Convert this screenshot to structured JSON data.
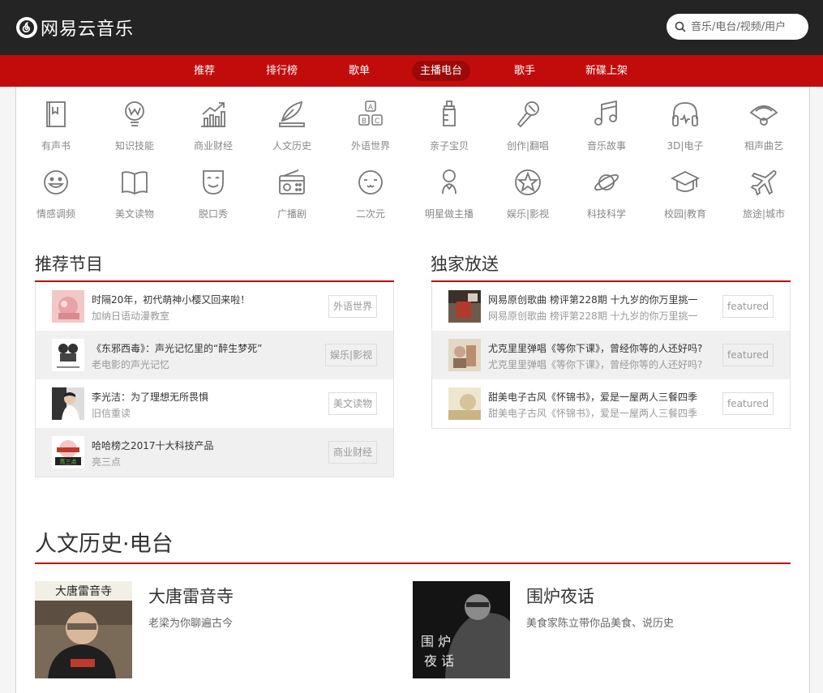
{
  "header": {
    "logo_text": "网易云音乐",
    "search_placeholder": "音乐/电台/视频/用户"
  },
  "nav": {
    "tabs": [
      "推荐",
      "排行榜",
      "歌单",
      "主播电台",
      "歌手",
      "新碟上架"
    ],
    "active": "主播电台"
  },
  "categories": [
    {
      "label": "有声书",
      "icon": "book-icon"
    },
    {
      "label": "知识技能",
      "icon": "lightbulb-icon"
    },
    {
      "label": "商业财经",
      "icon": "chart-icon"
    },
    {
      "label": "人文历史",
      "icon": "feather-icon"
    },
    {
      "label": "外语世界",
      "icon": "abc-blocks-icon"
    },
    {
      "label": "亲子宝贝",
      "icon": "baby-bottle-icon"
    },
    {
      "label": "创作|翻唱",
      "icon": "microphone-icon"
    },
    {
      "label": "音乐故事",
      "icon": "music-note-icon"
    },
    {
      "label": "3D|电子",
      "icon": "headphones-icon"
    },
    {
      "label": "相声曲艺",
      "icon": "fan-icon"
    },
    {
      "label": "情感调频",
      "icon": "smile-icon"
    },
    {
      "label": "美文读物",
      "icon": "open-book-icon"
    },
    {
      "label": "脱口秀",
      "icon": "mask-icon"
    },
    {
      "label": "广播剧",
      "icon": "radio-icon"
    },
    {
      "label": "二次元",
      "icon": "anime-face-icon"
    },
    {
      "label": "明星做主播",
      "icon": "person-icon"
    },
    {
      "label": "娱乐|影视",
      "icon": "star-icon"
    },
    {
      "label": "科技科学",
      "icon": "planet-icon"
    },
    {
      "label": "校园|教育",
      "icon": "graduation-cap-icon"
    },
    {
      "label": "旅途|城市",
      "icon": "airplane-icon"
    }
  ],
  "recommended": {
    "title": "推荐节目",
    "items": [
      {
        "title": "时隔20年，初代萌神小樱又回来啦！",
        "sub": "加纳日语动漫教室",
        "tag": "外语世界"
      },
      {
        "title": "《东邪西毒》：声光记忆里的“醉生梦死”",
        "sub": "老电影的声光记忆",
        "tag": "娱乐|影视"
      },
      {
        "title": "李光洁：为了理想无所畏惧",
        "sub": "旧信重读",
        "tag": "美文读物"
      },
      {
        "title": "哈哈榜之2017十大科技产品",
        "sub": "亮三点",
        "tag": "商业财经"
      }
    ]
  },
  "exclusive": {
    "title": "独家放送",
    "items": [
      {
        "title": "网易原创歌曲 榜评第228期 十九岁的你万里挑一",
        "sub": "网易原创歌曲 榜评第228期 十九岁的你万里挑一",
        "tag": "featured"
      },
      {
        "title": "尤克里里弹唱《等你下课》，曾经你等的人还好吗?",
        "sub": "尤克里里弹唱《等你下课》，曾经你等的人还好吗?",
        "tag": "featured"
      },
      {
        "title": "甜美电子古风《怀锦书》，爱是一屋两人三餐四季",
        "sub": "甜美电子古风《怀锦书》，爱是一屋两人三餐四季",
        "tag": "featured"
      }
    ]
  },
  "history_section": {
    "title": "人文历史·电台",
    "radios": [
      {
        "name": "大唐雷音寺",
        "desc": "老梁为你聊遍古今",
        "cover_text": "大唐雷音寺"
      },
      {
        "name": "围炉夜话",
        "desc": "美食家陈立带你品美食、说历史",
        "cover_text": "围炉夜话"
      }
    ]
  },
  "colors": {
    "brand_red": "#c20c0c",
    "top_bar": "#242424",
    "icon_gray": "#777777"
  }
}
